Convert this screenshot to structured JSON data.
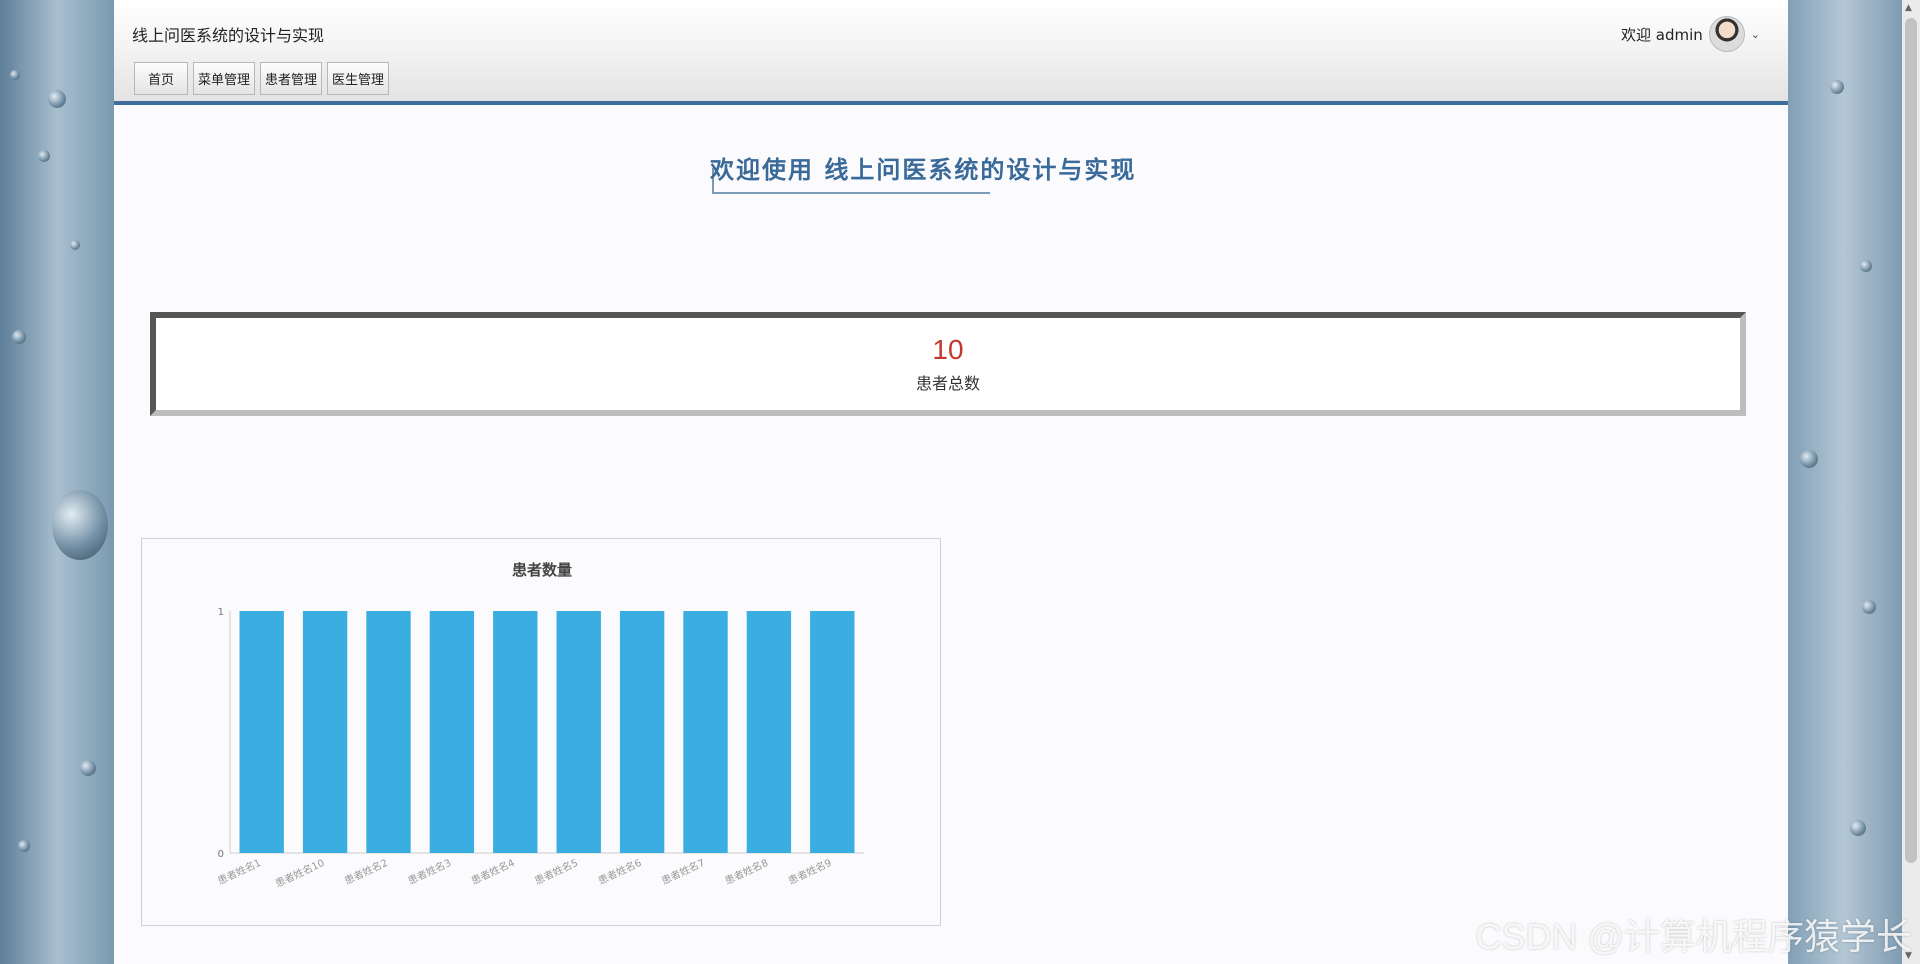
{
  "header": {
    "app_title": "线上问医系统的设计与实现",
    "user_greeting": "欢迎 admin"
  },
  "nav": {
    "items": [
      {
        "label": "首页"
      },
      {
        "label": "菜单管理"
      },
      {
        "label": "患者管理"
      },
      {
        "label": "医生管理"
      }
    ]
  },
  "main": {
    "welcome": "欢迎使用 线上问医系统的设计与实现",
    "stat_value": "10",
    "stat_label": "患者总数"
  },
  "chart_data": {
    "type": "bar",
    "title": "患者数量",
    "categories": [
      "患者姓名1",
      "患者姓名10",
      "患者姓名2",
      "患者姓名3",
      "患者姓名4",
      "患者姓名5",
      "患者姓名6",
      "患者姓名7",
      "患者姓名8",
      "患者姓名9"
    ],
    "values": [
      1,
      1,
      1,
      1,
      1,
      1,
      1,
      1,
      1,
      1
    ],
    "ylim": [
      0,
      1
    ],
    "yticks": [
      "0",
      "1"
    ],
    "xlabel": "",
    "ylabel": "",
    "colors": {
      "bar": "#3aaee0"
    }
  },
  "watermark": "CSDN @计算机程序猿学长",
  "colors": {
    "accent": "#3f6d9c",
    "stat_value": "#c0392b"
  }
}
